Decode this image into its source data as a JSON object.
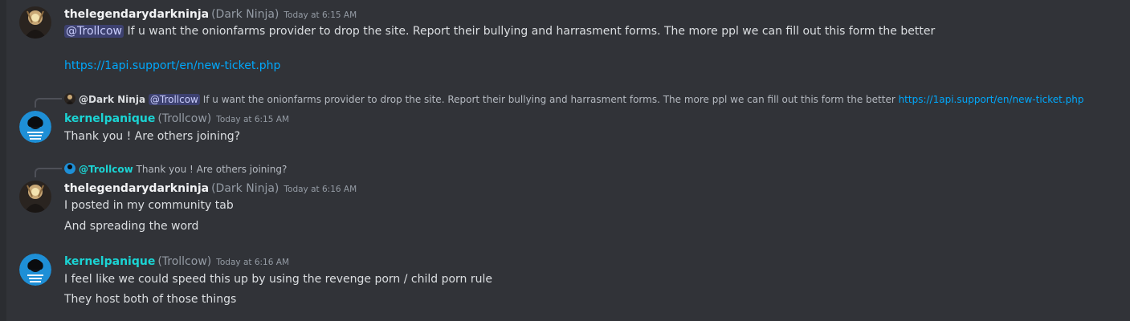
{
  "colors": {
    "background": "#313338",
    "ninja_name": "#f2f3f5",
    "kernel_name": "#1bd4d4",
    "mention_bg": "#3c4270",
    "link": "#00a8fc"
  },
  "messages": [
    {
      "username": "thelegendarydarkninja",
      "nickname": "(Dark Ninja)",
      "timestamp": "Today at 6:15 AM",
      "mention": "@Trollcow",
      "text": " If u want the onionfarms provider to drop the site. Report their bullying and harrasment forms. The more ppl we can fill out this form the better",
      "link": "https://1api.support/en/new-ticket.php"
    },
    {
      "reply": {
        "author": "@Dark Ninja",
        "mention": "@Trollcow",
        "text": " If u want the onionfarms provider to drop the site. Report their bullying and harrasment forms. The more ppl we can fill out this form the better ",
        "link": "https://1api.support/en/new-ticket.php"
      },
      "username": "kernelpanique",
      "nickname": "(Trollcow)",
      "timestamp": "Today at 6:15 AM",
      "text": "Thank you ! Are others joining?"
    },
    {
      "reply": {
        "author": "@Trollcow",
        "text": " Thank you ! Are others joining?"
      },
      "username": "thelegendarydarkninja",
      "nickname": "(Dark Ninja)",
      "timestamp": "Today at 6:16 AM",
      "lines": [
        "I posted in my community tab",
        "And spreading the word"
      ]
    },
    {
      "username": "kernelpanique",
      "nickname": "(Trollcow)",
      "timestamp": "Today at 6:16 AM",
      "lines": [
        "I feel like we could speed this up by using the revenge porn / child porn rule",
        "They host both of those things"
      ]
    }
  ]
}
